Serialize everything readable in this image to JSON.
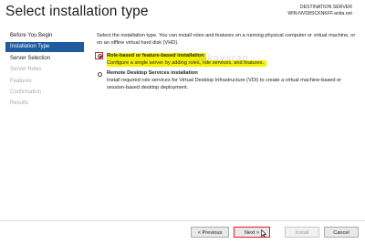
{
  "window": {
    "title": "Select installation type",
    "destination_label": "DESTINATION SERVER",
    "destination_server": "WIN-NVD8SCKNKFF.anita.net"
  },
  "sidebar": {
    "items": [
      {
        "label": "Before You Begin",
        "state": "normal"
      },
      {
        "label": "Installation Type",
        "state": "active"
      },
      {
        "label": "Server Selection",
        "state": "normal"
      },
      {
        "label": "Server Roles",
        "state": "disabled"
      },
      {
        "label": "Features",
        "state": "disabled"
      },
      {
        "label": "Confirmation",
        "state": "disabled"
      },
      {
        "label": "Results",
        "state": "disabled"
      }
    ]
  },
  "main": {
    "intro": "Select the installation type. You can install roles and features on a running physical computer or virtual machine, or on an offline virtual hard disk (VHD).",
    "options": [
      {
        "title": "Role-based or feature-based installation",
        "description": "Configure a single server by adding roles, role services, and features.",
        "selected": true
      },
      {
        "title": "Remote Desktop Services installation",
        "description": "Install required role services for Virtual Desktop Infrastructure (VDI) to create a virtual machine-based or session-based desktop deployment.",
        "selected": false
      }
    ],
    "watermark": "Jakavaran"
  },
  "footer": {
    "previous_label": "< Previous",
    "next_label": "Next >",
    "install_label": "Install",
    "cancel_label": "Cancel"
  },
  "colors": {
    "active_nav": "#1f5c9d",
    "highlight": "#f3f200",
    "annotation_red": "#e41e26"
  }
}
